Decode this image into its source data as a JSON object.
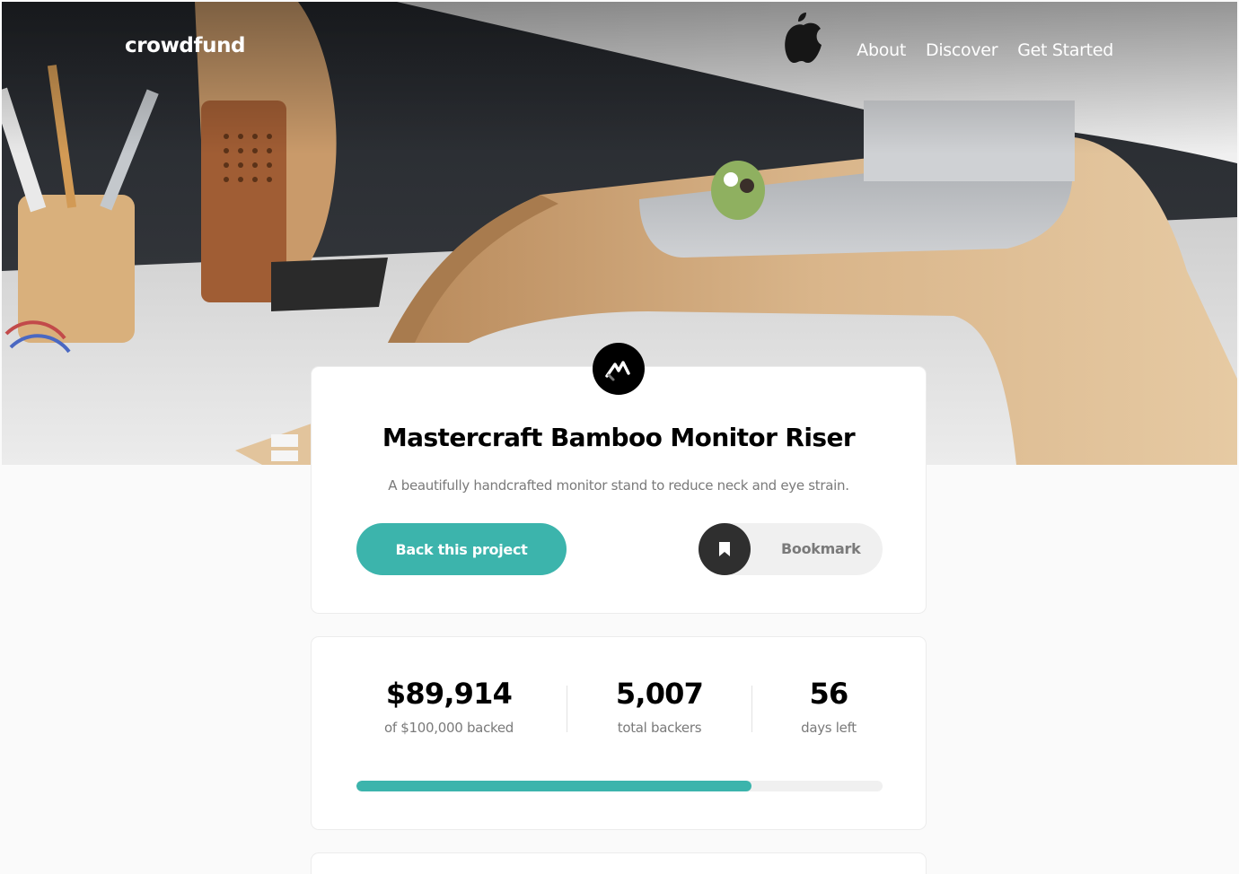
{
  "header": {
    "logo": "crowdfund",
    "nav": [
      "About",
      "Discover",
      "Get Started"
    ]
  },
  "project": {
    "title": "Mastercraft Bamboo Monitor Riser",
    "description": "A beautifully handcrafted monitor stand to reduce neck and eye strain.",
    "back_button_label": "Back this project",
    "bookmark_label": "Bookmark"
  },
  "stats": {
    "backed_amount": "$89,914",
    "backed_label": "of $100,000 backed",
    "backers_count": "5,007",
    "backers_label": "total backers",
    "days_left": "56",
    "days_label": "days left",
    "progress_fraction": 0.75
  },
  "icons": {
    "project_logo": "mastercraft-logo-icon",
    "bookmark": "bookmark-icon"
  },
  "colors": {
    "accent": "#3cb4ac",
    "dark": "#2f2f2f"
  }
}
